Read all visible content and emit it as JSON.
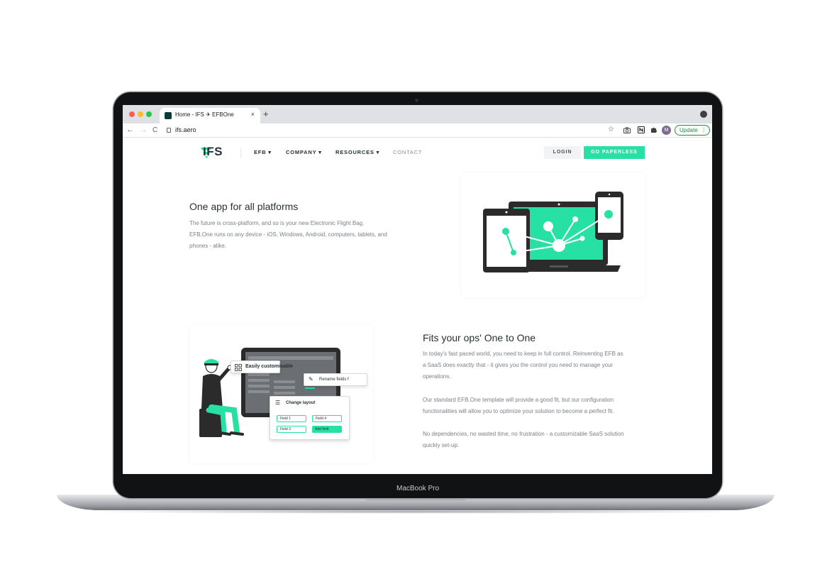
{
  "device": {
    "label": "MacBook Pro"
  },
  "browser": {
    "tab_title": "Home - IFS ✈ EFBOne",
    "tab_close": "×",
    "new_tab": "+",
    "url": "ifs.aero",
    "back": "←",
    "forward": "→",
    "reload": "C",
    "star": "☆",
    "update_label": "Update",
    "avatar_initial": "M",
    "menu": "⋮"
  },
  "site": {
    "logo_text": "IFS",
    "nav": {
      "efb": "EFB ▾",
      "company": "COMPANY ▾",
      "resources": "RESOURCES ▾",
      "contact": "CONTACT"
    },
    "login_label": "LOGIN",
    "cta_label": "GO PAPERLESS",
    "colors": {
      "accent": "#27e1a4",
      "dark": "#263238"
    }
  },
  "section1": {
    "title": "One app for all platforms",
    "line1": "The future is cross-platform, and so is your new Electronic Flight Bag.",
    "line2": "EFB.One runs on any device - iOS, Windows, Android, computers, tablets, and",
    "line3": "phones - alike."
  },
  "section2": {
    "title": "Fits your ops' One to One",
    "p1_line1": "In today's fast paced world, you need to keep in full control. Reinventing EFB as",
    "p1_line2": "a SaaS does exactly that - it gives you the control you need to manage your",
    "p1_line3": "operations.",
    "p2_line1": "Our standard EFB.One template will provide a good fit, but our configuration",
    "p2_line2": "functionalities will allow you to optimize your solution to become a perfect fit.",
    "p3_line1": "No dependencies, no wasted time, no frustration - a customizable SaaS solution",
    "p3_line2": "quickly set-up."
  },
  "illustration": {
    "easily_label": "Easily customisable",
    "rename_label": "Rename fields f",
    "change_layout_label": "Change layout",
    "field1": "Field 1",
    "field4": "Field 4",
    "field2": "Field 2",
    "add_field": "Add field"
  }
}
